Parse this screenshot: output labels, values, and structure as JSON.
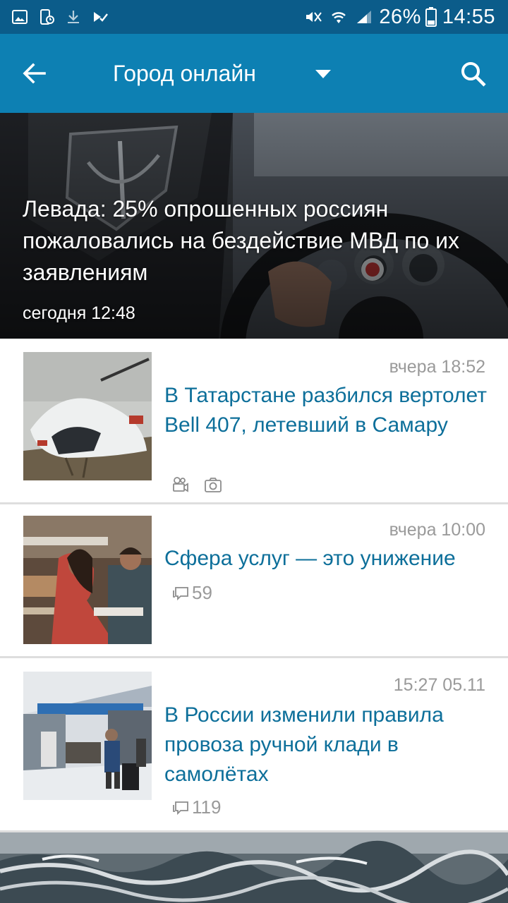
{
  "status_bar": {
    "battery": "26%",
    "time": "14:55"
  },
  "app_bar": {
    "title": "Город онлайн"
  },
  "hero": {
    "title": "Левада: 25% опрошенных россиян пожаловались на бездействие МВД по их заявлениям",
    "time": "сегодня 12:48"
  },
  "news": [
    {
      "time": "вчера 18:52",
      "title": "В Татарстане разбился вертолет Bell 407, летевший в Самару",
      "has_video": true,
      "has_photo": true
    },
    {
      "time": "вчера 10:00",
      "title": "Сфера услуг — это унижение",
      "comments": "59"
    },
    {
      "time": "15:27 05.11",
      "title": "В России изменили правила провоза ручной клади в самолётах",
      "comments": "119"
    }
  ],
  "colors": {
    "status_bar": "#0b5c8a",
    "app_bar": "#0d80b3",
    "link_title": "#0d6f9a",
    "muted": "#9a9a9a"
  }
}
